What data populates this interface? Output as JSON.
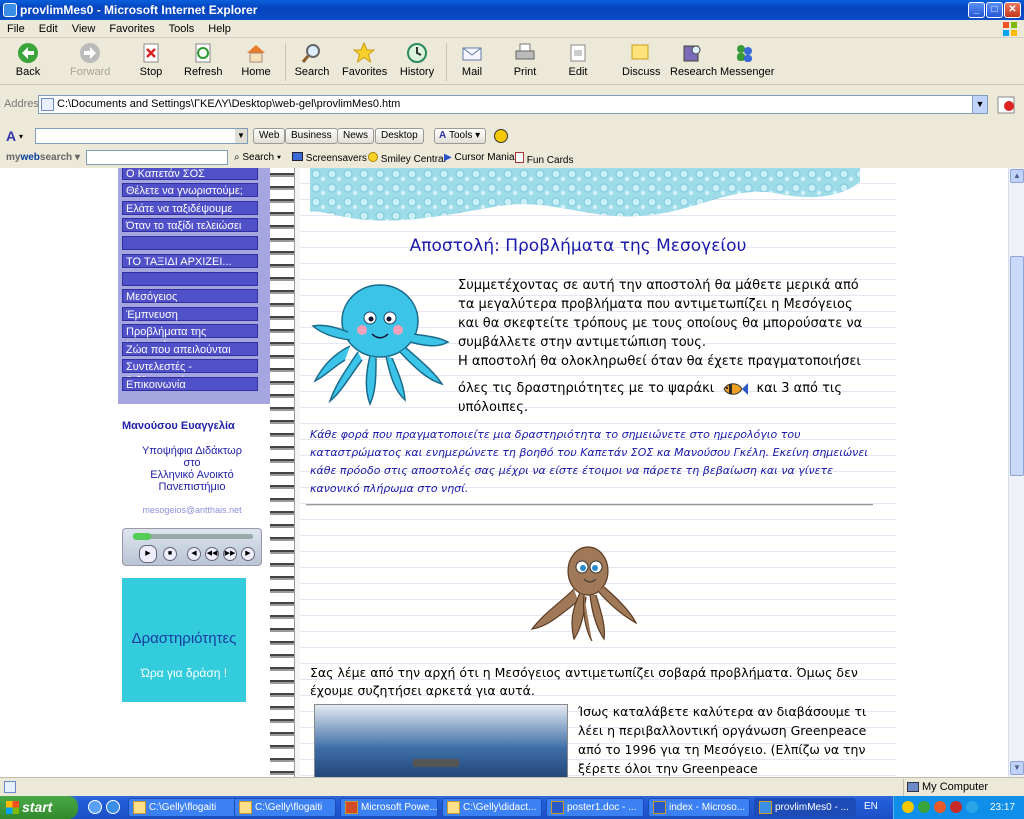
{
  "window": {
    "title": "provlimMes0 - Microsoft Internet Explorer"
  },
  "menu": [
    "File",
    "Edit",
    "View",
    "Favorites",
    "Tools",
    "Help"
  ],
  "toolbar": {
    "back": "Back",
    "forward": "Forward",
    "stop": "Stop",
    "refresh": "Refresh",
    "home": "Home",
    "search": "Search",
    "favorites": "Favorites",
    "history": "History",
    "mail": "Mail",
    "print": "Print",
    "edit": "Edit",
    "discuss": "Discuss",
    "research": "Research",
    "messenger": "Messenger"
  },
  "address": {
    "label": "Address",
    "value": "C:\\Documents and Settings\\ΓΚΕΛΥ\\Desktop\\web-gel\\provlimMes0.htm"
  },
  "toolbar2": {
    "web": "Web",
    "business": "Business",
    "news": "News",
    "desktop": "Desktop",
    "tools": "Tools"
  },
  "toolbar3": {
    "brand_my": "my",
    "brand_web": "web",
    "brand_search": "search",
    "search": "Search",
    "screensavers": "Screensavers",
    "smiley": "Smiley Central",
    "cursor": "Cursor Mania",
    "funcards": "Fun Cards"
  },
  "sidebar": {
    "items": [
      "Ο Καπετάν ΣΟΣ",
      "Θέλετε να γνωριστούμε;",
      "Ελάτε να ταξιδέψουμε",
      "Όταν το ταξίδι τελειώσει",
      "",
      "ΤΟ ΤΑΞΙΔΙ ΑΡΧΙΖΕΙ...",
      "",
      "Μεσόγειος",
      "Έμπνευση",
      "Προβλήματα της Μεσογείου",
      "Ζώα που απειλούνται",
      "Συντελεστές - Βιβλιογραφία",
      "Επικοινωνία"
    ],
    "author": "Μανούσου Ευαγγελία",
    "affil1": "Υποψήφια Διδάκτωρ",
    "affil2": "στο",
    "affil3": "Ελληνικό Ανοικτό",
    "affil4": "Πανεπιστήμιο",
    "email": "mesogeios@antthais.net",
    "activity_title": "Δραστηριότητες",
    "activity_sub": "Ώρα για δράση !"
  },
  "main": {
    "heading": "Αποστολή: Προβλήματα της Μεσογείου",
    "intro1": "Συμμετέχοντας σε αυτή την αποστολή θα μάθετε μερικά από τα μεγαλύτερα προβλήματα που αντιμετωπίζει η Μεσόγειος και θα σκεφτείτε τρόπους με τους οποίους θα μπορούσατε να συμβάλλετε στην αντιμετώπιση τους.",
    "intro2": "Η αποστολή θα ολοκληρωθεί όταν θα έχετε πραγματοποιήσει",
    "intro3a": "όλες τις δραστηριότητες με το ψαράκι",
    "intro3b": "και 3 από τις υπόλοιπες.",
    "blue": "Κάθε φορά που πραγματοποιείτε μια δραστηριότητα το σημειώνετε στο ημερολόγιο του καταστρώματος και ενημερώνετε τη βοηθό του Καπετάν ΣΟΣ κα Μανούσου Γκέλη. Εκείνη σημειώνει κάθε πρόοδο στις αποστολές σας μέχρι να είστε έτοιμοι να πάρετε τη βεβαίωση και να γίνετε κανονικό πλήρωμα στο νησί.",
    "problem": "Σας λέμε από την αρχή ότι η Μεσόγειος αντιμετωπίζει σοβαρά προβλήματα. Όμως δεν έχουμε συζητήσει αρκετά για αυτά.",
    "greenpeace": "Ίσως καταλάβετε καλύτερα αν διαβάσουμε τι λέει η περιβαλλοντική οργάνωση Greenpeace από το 1996 για τη Μεσόγειο. (Ελπίζω να την ξέρετε όλοι την Greenpeace"
  },
  "status": {
    "zone": "My Computer"
  },
  "taskbar": {
    "start": "start",
    "tasks": [
      "C:\\Gelly\\flogaiti",
      "C:\\Gelly\\flogaiti",
      "Microsoft Powe...",
      "C:\\Gelly\\didact...",
      "poster1.doc - ...",
      "index - Microso...",
      "provlimMes0 - ..."
    ],
    "lang": "EN",
    "clock": "23:17"
  }
}
